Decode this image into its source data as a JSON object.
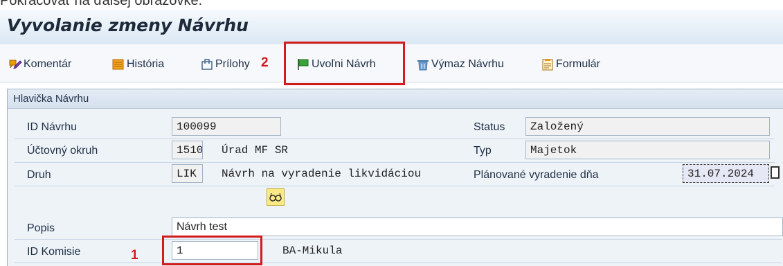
{
  "cutoff_text": "Pokračovať na ďalšej obrazovke.",
  "title": "Vyvolanie zmeny Návrhu",
  "toolbar": {
    "comment": "Komentár",
    "history": "História",
    "attachments": "Prílohy",
    "release": "Uvoľni Návrh",
    "delete": "Výmaz Návrhu",
    "form": "Formulár"
  },
  "markers": {
    "m1": "1",
    "m2": "2"
  },
  "panel_title": "Hlavička Návrhu",
  "fields": {
    "id_label": "ID Návrhu",
    "id_value": "100099",
    "status_label": "Status",
    "status_value": "Založený",
    "okruh_label": "Účtovný okruh",
    "okruh_code": "1510",
    "okruh_text": "Úrad MF SR",
    "typ_label": "Typ",
    "typ_value": "Majetok",
    "druh_label": "Druh",
    "druh_code": "LIK",
    "druh_text": "Návrh na vyradenie likvidáciou",
    "datum_label": "Plánované vyradenie dňa",
    "datum_value": "31.07.2024",
    "popis_label": "Popis",
    "popis_value": "Návrh test",
    "komisia_label": "ID Komisie",
    "komisia_value": "1",
    "komisia_text": "BA-Mikula"
  },
  "colors": {
    "highlight": "#d21c1c",
    "accent_yellow": "#fbe983"
  }
}
